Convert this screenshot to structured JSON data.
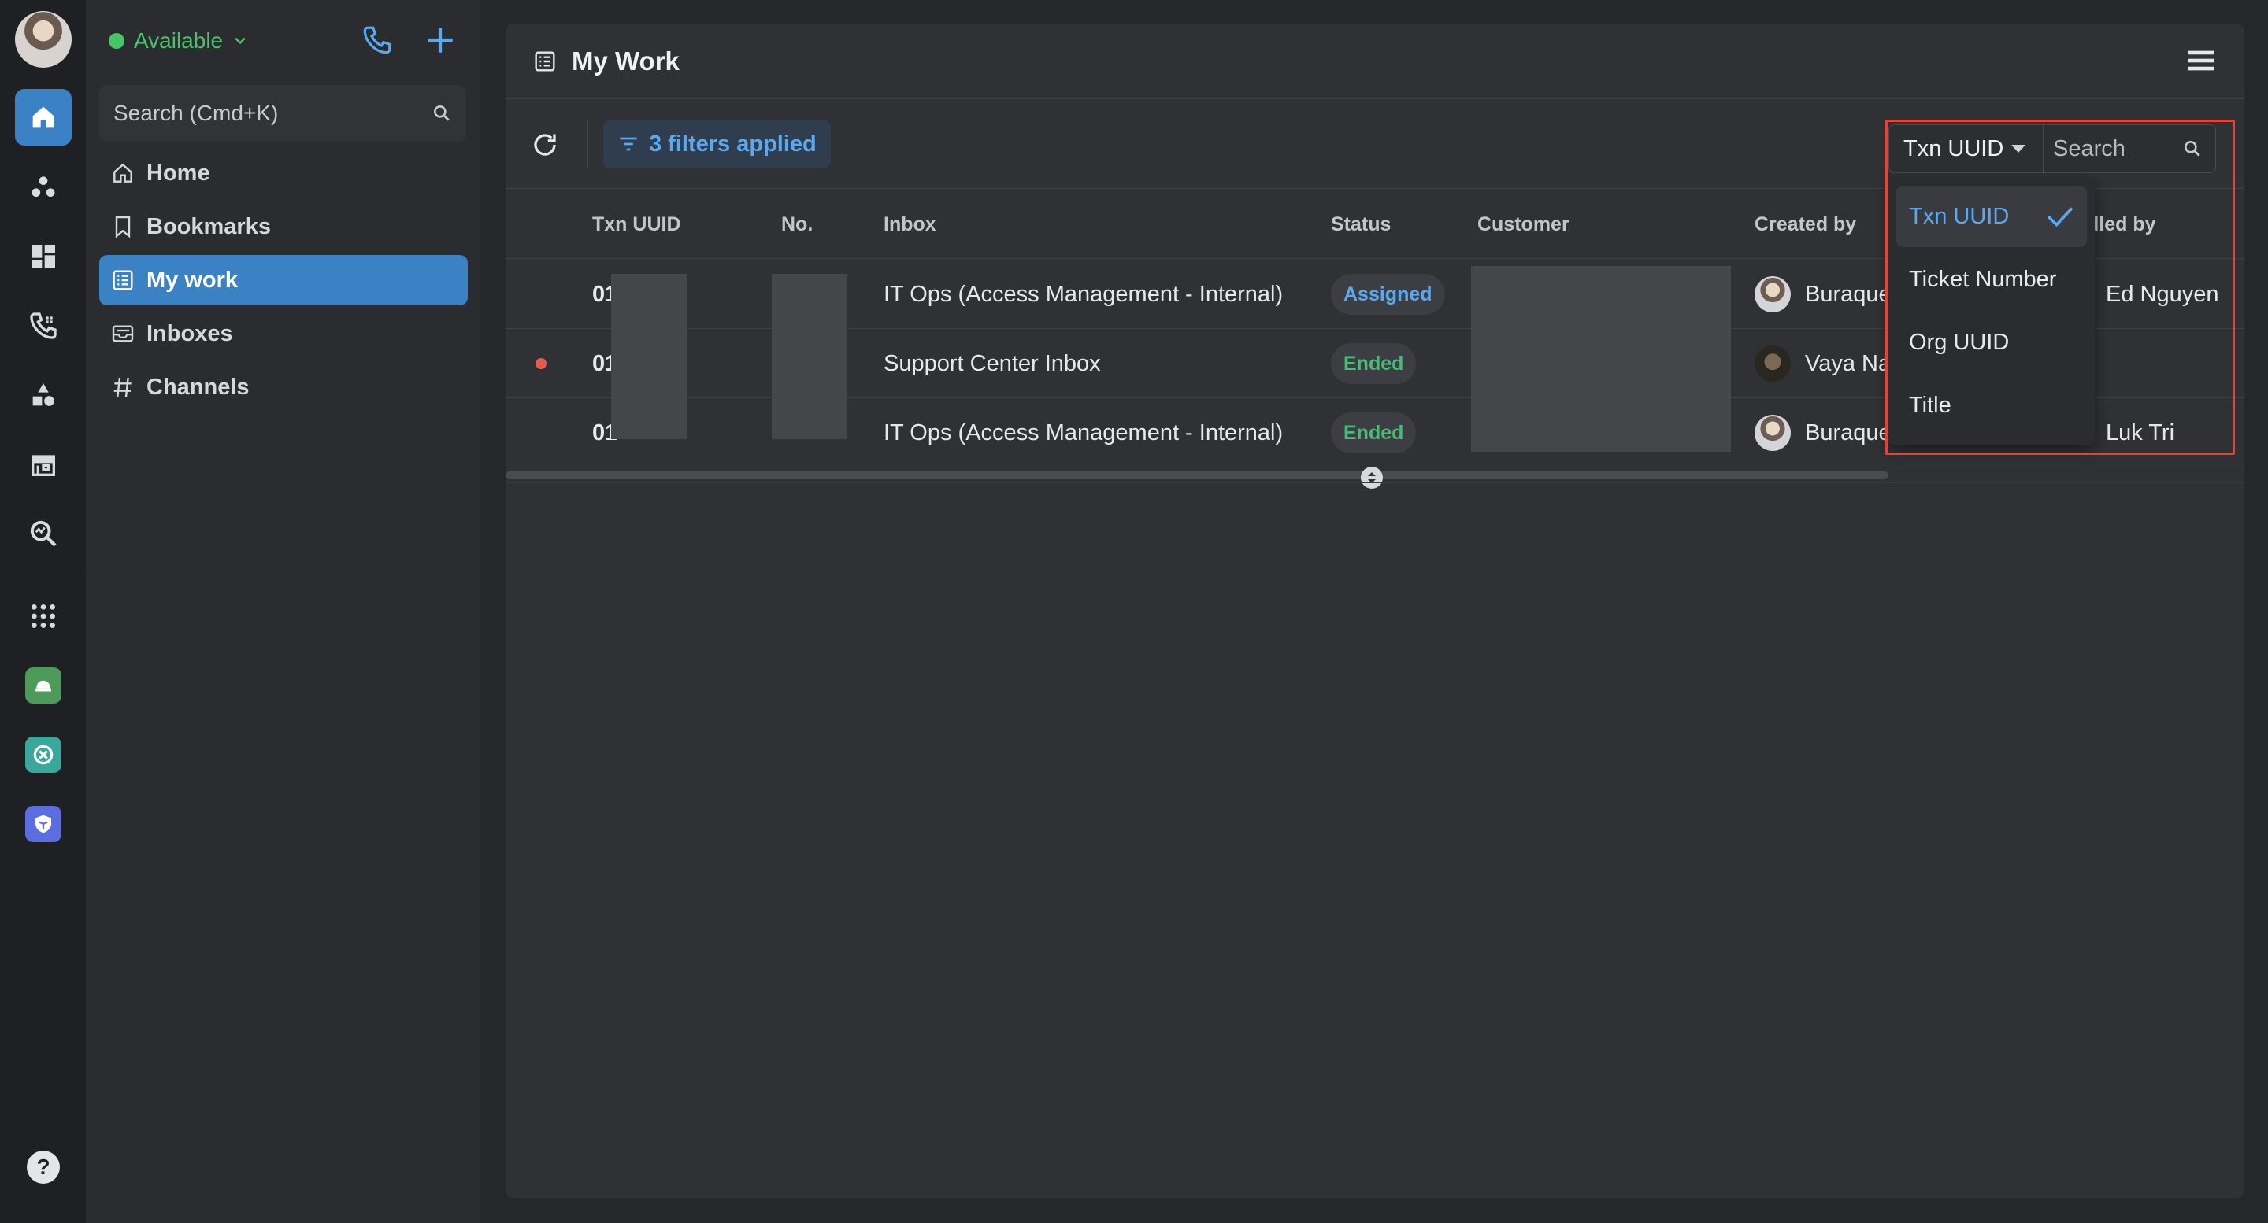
{
  "sidebar": {
    "status_label": "Available",
    "search_placeholder": "Search (Cmd+K)",
    "nav": [
      {
        "label": "Home",
        "icon": "home-outline-icon"
      },
      {
        "label": "Bookmarks",
        "icon": "bookmark-icon"
      },
      {
        "label": "My work",
        "icon": "list-icon"
      },
      {
        "label": "Inboxes",
        "icon": "inbox-icon"
      },
      {
        "label": "Channels",
        "icon": "hash-icon"
      }
    ]
  },
  "rail": {
    "items": [
      "home-icon",
      "people-icon",
      "dashboard-icon",
      "phone-call-icon",
      "shapes-icon",
      "store-icon",
      "search-analytics-icon",
      "apps-grid-icon"
    ],
    "help_label": "?"
  },
  "main": {
    "title": "My Work",
    "filters_label": "3 filters applied",
    "search": {
      "field_label": "Txn UUID",
      "placeholder": "Search",
      "options": [
        "Txn UUID",
        "Ticket Number",
        "Org UUID",
        "Title"
      ],
      "selected": "Txn UUID"
    },
    "columns": [
      "Txn UUID",
      "No.",
      "Inbox",
      "Status",
      "Customer",
      "Created by",
      "dled by"
    ],
    "rows": [
      {
        "txn": "01",
        "inbox": "IT Ops (Access Management - Internal)",
        "status": "Assigned",
        "created_by": "Buraque",
        "handled_by": "Ed Nguyen",
        "unread": false
      },
      {
        "txn": "01",
        "inbox": "Support Center Inbox",
        "status": "Ended",
        "created_by": "Vaya Na",
        "handled_by": "",
        "unread": true
      },
      {
        "txn": "01",
        "inbox": "IT Ops (Access Management - Internal)",
        "status": "Ended",
        "created_by": "Buraque",
        "handled_by": "Luk Tri",
        "unread": false
      }
    ]
  },
  "colors": {
    "accent": "#3b82c4",
    "link": "#5aa9f0",
    "status_green": "#47c466",
    "highlight": "#e0453a"
  }
}
